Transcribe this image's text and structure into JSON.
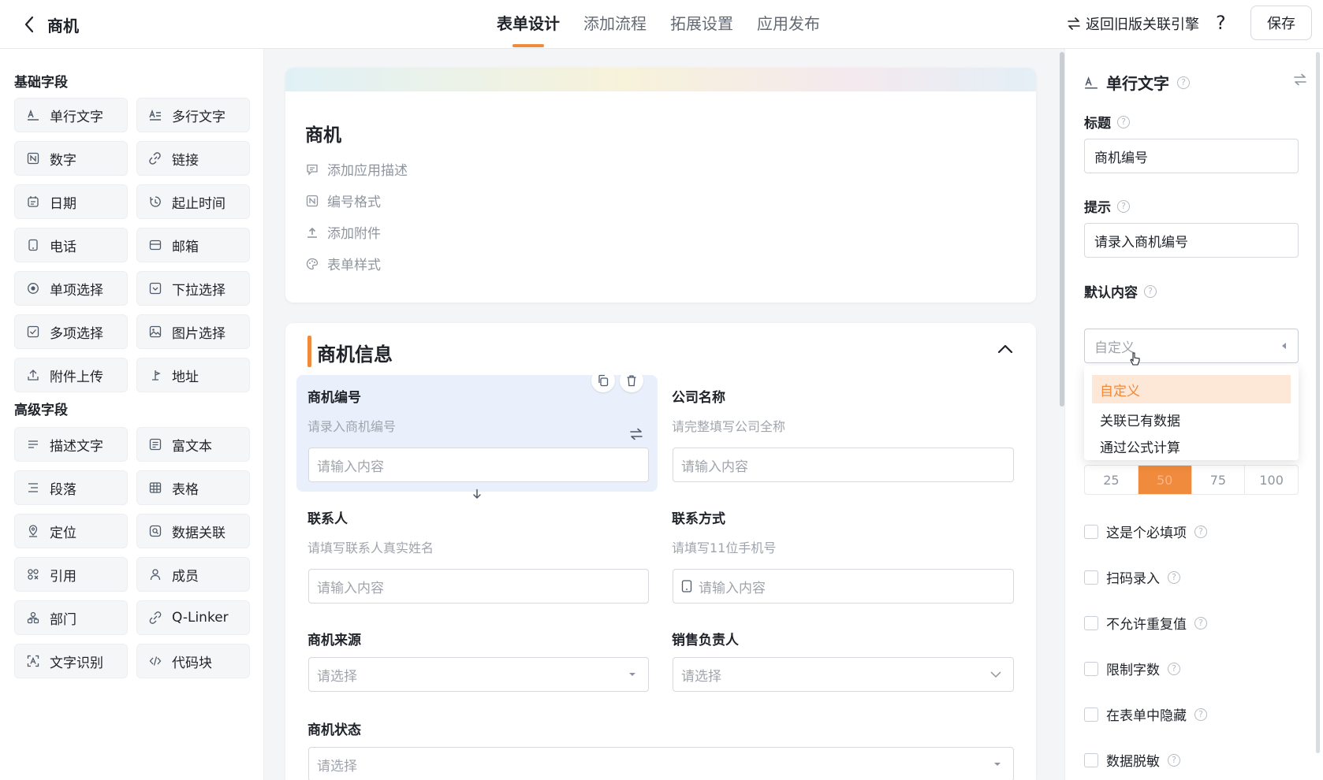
{
  "header": {
    "app_name": "商机",
    "tabs": [
      {
        "label": "表单设计",
        "active": true
      },
      {
        "label": "添加流程",
        "active": false
      },
      {
        "label": "拓展设置",
        "active": false
      },
      {
        "label": "应用发布",
        "active": false
      }
    ],
    "legacy_link": "返回旧版关联引擎",
    "help": "?",
    "save_label": "保存"
  },
  "palette": {
    "basic_title": "基础字段",
    "basic": [
      {
        "label": "单行文字",
        "icon": "single-line-text-icon"
      },
      {
        "label": "多行文字",
        "icon": "multi-line-text-icon"
      },
      {
        "label": "数字",
        "icon": "number-icon"
      },
      {
        "label": "链接",
        "icon": "link-icon"
      },
      {
        "label": "日期",
        "icon": "calendar-icon"
      },
      {
        "label": "起止时间",
        "icon": "time-range-icon"
      },
      {
        "label": "电话",
        "icon": "phone-icon"
      },
      {
        "label": "邮箱",
        "icon": "mail-icon"
      },
      {
        "label": "单项选择",
        "icon": "radio-icon"
      },
      {
        "label": "下拉选择",
        "icon": "dropdown-icon"
      },
      {
        "label": "多项选择",
        "icon": "checkbox-icon"
      },
      {
        "label": "图片选择",
        "icon": "image-icon"
      },
      {
        "label": "附件上传",
        "icon": "upload-icon"
      },
      {
        "label": "地址",
        "icon": "location-pin-icon"
      }
    ],
    "advanced_title": "高级字段",
    "advanced": [
      {
        "label": "描述文字",
        "icon": "description-icon"
      },
      {
        "label": "富文本",
        "icon": "rich-text-icon"
      },
      {
        "label": "段落",
        "icon": "paragraph-icon"
      },
      {
        "label": "表格",
        "icon": "table-icon"
      },
      {
        "label": "定位",
        "icon": "locate-icon"
      },
      {
        "label": "数据关联",
        "icon": "data-link-icon"
      },
      {
        "label": "引用",
        "icon": "reference-icon"
      },
      {
        "label": "成员",
        "icon": "member-icon"
      },
      {
        "label": "部门",
        "icon": "department-icon"
      },
      {
        "label": "Q-Linker",
        "icon": "qlinker-icon"
      },
      {
        "label": "文字识别",
        "icon": "ocr-icon"
      },
      {
        "label": "代码块",
        "icon": "code-icon"
      }
    ]
  },
  "form": {
    "title": "商机",
    "meta": [
      {
        "label": "添加应用描述",
        "icon": "comment-icon"
      },
      {
        "label": "编号格式",
        "icon": "number-format-icon"
      },
      {
        "label": "添加附件",
        "icon": "upload-icon"
      },
      {
        "label": "表单样式",
        "icon": "palette-icon"
      }
    ],
    "section_title": "商机信息",
    "fields": {
      "opp_no": {
        "label": "商机编号",
        "hint": "请录入商机编号",
        "placeholder": "请输入内容"
      },
      "company": {
        "label": "公司名称",
        "hint": "请完整填写公司全称",
        "placeholder": "请输入内容"
      },
      "contact": {
        "label": "联系人",
        "hint": "请填写联系人真实姓名",
        "placeholder": "请输入内容"
      },
      "phone": {
        "label": "联系方式",
        "hint": "请填写11位手机号",
        "placeholder": "请输入内容"
      },
      "source": {
        "label": "商机来源",
        "placeholder": "请选择"
      },
      "owner": {
        "label": "销售负责人",
        "placeholder": "请选择"
      },
      "status": {
        "label": "商机状态",
        "placeholder": "请选择"
      }
    }
  },
  "props": {
    "field_type": "单行文字",
    "title_label": "标题",
    "title_value": "商机编号",
    "hint_label": "提示",
    "hint_value": "请录入商机编号",
    "default_label": "默认内容",
    "default_value": "自定义",
    "dropdown_options": [
      "自定义",
      "关联已有数据",
      "通过公式计算"
    ],
    "width_options": [
      "25",
      "50",
      "75",
      "100"
    ],
    "width_selected": "50",
    "checkboxes": [
      "这是个必填项",
      "扫码录入",
      "不允许重复值",
      "限制字数",
      "在表单中隐藏",
      "数据脱敏"
    ]
  },
  "colors": {
    "accent": "#f08a3c",
    "selected_bg": "#eaf0fb"
  }
}
